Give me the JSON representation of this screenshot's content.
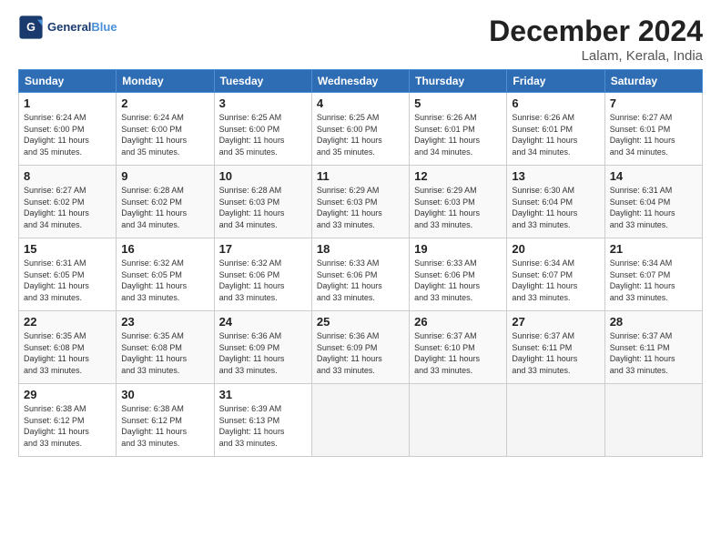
{
  "logo": {
    "part1": "General",
    "part2": "Blue"
  },
  "title": "December 2024",
  "location": "Lalam, Kerala, India",
  "days_of_week": [
    "Sunday",
    "Monday",
    "Tuesday",
    "Wednesday",
    "Thursday",
    "Friday",
    "Saturday"
  ],
  "weeks": [
    [
      {
        "day": "1",
        "detail": "Sunrise: 6:24 AM\nSunset: 6:00 PM\nDaylight: 11 hours\nand 35 minutes."
      },
      {
        "day": "2",
        "detail": "Sunrise: 6:24 AM\nSunset: 6:00 PM\nDaylight: 11 hours\nand 35 minutes."
      },
      {
        "day": "3",
        "detail": "Sunrise: 6:25 AM\nSunset: 6:00 PM\nDaylight: 11 hours\nand 35 minutes."
      },
      {
        "day": "4",
        "detail": "Sunrise: 6:25 AM\nSunset: 6:00 PM\nDaylight: 11 hours\nand 35 minutes."
      },
      {
        "day": "5",
        "detail": "Sunrise: 6:26 AM\nSunset: 6:01 PM\nDaylight: 11 hours\nand 34 minutes."
      },
      {
        "day": "6",
        "detail": "Sunrise: 6:26 AM\nSunset: 6:01 PM\nDaylight: 11 hours\nand 34 minutes."
      },
      {
        "day": "7",
        "detail": "Sunrise: 6:27 AM\nSunset: 6:01 PM\nDaylight: 11 hours\nand 34 minutes."
      }
    ],
    [
      {
        "day": "8",
        "detail": "Sunrise: 6:27 AM\nSunset: 6:02 PM\nDaylight: 11 hours\nand 34 minutes."
      },
      {
        "day": "9",
        "detail": "Sunrise: 6:28 AM\nSunset: 6:02 PM\nDaylight: 11 hours\nand 34 minutes."
      },
      {
        "day": "10",
        "detail": "Sunrise: 6:28 AM\nSunset: 6:03 PM\nDaylight: 11 hours\nand 34 minutes."
      },
      {
        "day": "11",
        "detail": "Sunrise: 6:29 AM\nSunset: 6:03 PM\nDaylight: 11 hours\nand 33 minutes."
      },
      {
        "day": "12",
        "detail": "Sunrise: 6:29 AM\nSunset: 6:03 PM\nDaylight: 11 hours\nand 33 minutes."
      },
      {
        "day": "13",
        "detail": "Sunrise: 6:30 AM\nSunset: 6:04 PM\nDaylight: 11 hours\nand 33 minutes."
      },
      {
        "day": "14",
        "detail": "Sunrise: 6:31 AM\nSunset: 6:04 PM\nDaylight: 11 hours\nand 33 minutes."
      }
    ],
    [
      {
        "day": "15",
        "detail": "Sunrise: 6:31 AM\nSunset: 6:05 PM\nDaylight: 11 hours\nand 33 minutes."
      },
      {
        "day": "16",
        "detail": "Sunrise: 6:32 AM\nSunset: 6:05 PM\nDaylight: 11 hours\nand 33 minutes."
      },
      {
        "day": "17",
        "detail": "Sunrise: 6:32 AM\nSunset: 6:06 PM\nDaylight: 11 hours\nand 33 minutes."
      },
      {
        "day": "18",
        "detail": "Sunrise: 6:33 AM\nSunset: 6:06 PM\nDaylight: 11 hours\nand 33 minutes."
      },
      {
        "day": "19",
        "detail": "Sunrise: 6:33 AM\nSunset: 6:06 PM\nDaylight: 11 hours\nand 33 minutes."
      },
      {
        "day": "20",
        "detail": "Sunrise: 6:34 AM\nSunset: 6:07 PM\nDaylight: 11 hours\nand 33 minutes."
      },
      {
        "day": "21",
        "detail": "Sunrise: 6:34 AM\nSunset: 6:07 PM\nDaylight: 11 hours\nand 33 minutes."
      }
    ],
    [
      {
        "day": "22",
        "detail": "Sunrise: 6:35 AM\nSunset: 6:08 PM\nDaylight: 11 hours\nand 33 minutes."
      },
      {
        "day": "23",
        "detail": "Sunrise: 6:35 AM\nSunset: 6:08 PM\nDaylight: 11 hours\nand 33 minutes."
      },
      {
        "day": "24",
        "detail": "Sunrise: 6:36 AM\nSunset: 6:09 PM\nDaylight: 11 hours\nand 33 minutes."
      },
      {
        "day": "25",
        "detail": "Sunrise: 6:36 AM\nSunset: 6:09 PM\nDaylight: 11 hours\nand 33 minutes."
      },
      {
        "day": "26",
        "detail": "Sunrise: 6:37 AM\nSunset: 6:10 PM\nDaylight: 11 hours\nand 33 minutes."
      },
      {
        "day": "27",
        "detail": "Sunrise: 6:37 AM\nSunset: 6:11 PM\nDaylight: 11 hours\nand 33 minutes."
      },
      {
        "day": "28",
        "detail": "Sunrise: 6:37 AM\nSunset: 6:11 PM\nDaylight: 11 hours\nand 33 minutes."
      }
    ],
    [
      {
        "day": "29",
        "detail": "Sunrise: 6:38 AM\nSunset: 6:12 PM\nDaylight: 11 hours\nand 33 minutes."
      },
      {
        "day": "30",
        "detail": "Sunrise: 6:38 AM\nSunset: 6:12 PM\nDaylight: 11 hours\nand 33 minutes."
      },
      {
        "day": "31",
        "detail": "Sunrise: 6:39 AM\nSunset: 6:13 PM\nDaylight: 11 hours\nand 33 minutes."
      },
      {
        "day": "",
        "detail": ""
      },
      {
        "day": "",
        "detail": ""
      },
      {
        "day": "",
        "detail": ""
      },
      {
        "day": "",
        "detail": ""
      }
    ]
  ]
}
